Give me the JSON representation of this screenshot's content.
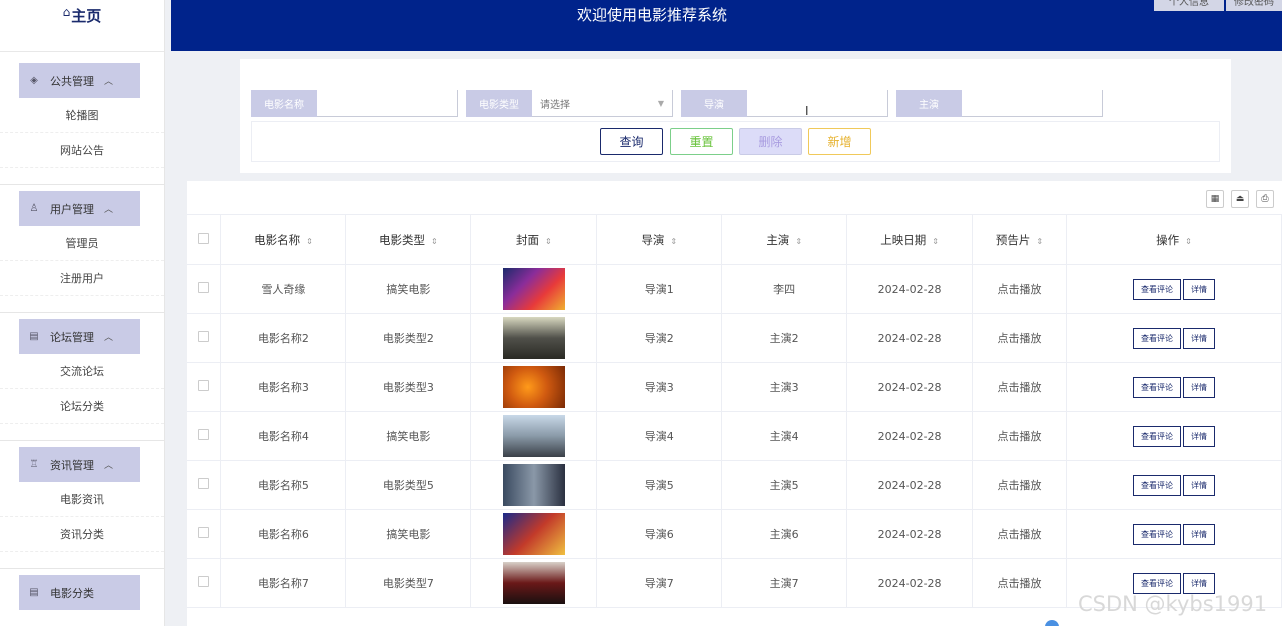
{
  "brand": {
    "icon": "⌂",
    "title": "主页"
  },
  "header": {
    "title": "欢迎使用电影推荐系统",
    "buttons": [
      "个人信息",
      "修改密码"
    ]
  },
  "sidebar": {
    "groups": [
      {
        "label": "公共管理",
        "icon": "layers-icon",
        "items": [
          "轮播图",
          "网站公告"
        ]
      },
      {
        "label": "用户管理",
        "icon": "user-icon",
        "items": [
          "管理员",
          "注册用户"
        ]
      },
      {
        "label": "论坛管理",
        "icon": "list-icon",
        "items": [
          "交流论坛",
          "论坛分类"
        ]
      },
      {
        "label": "资讯管理",
        "icon": "news-icon",
        "items": [
          "电影资讯",
          "资讯分类"
        ]
      },
      {
        "label": "电影分类",
        "icon": "list-icon",
        "items": []
      }
    ]
  },
  "search": {
    "fields": [
      {
        "label": "电影名称",
        "value": ""
      },
      {
        "label": "电影类型",
        "placeholder": "请选择"
      },
      {
        "label": "导演",
        "value": ""
      },
      {
        "label": "主演",
        "value": ""
      }
    ],
    "buttons": {
      "query": "查询",
      "reset": "重置",
      "delete": "删除",
      "add": "新增"
    }
  },
  "table": {
    "columns": [
      "电影名称",
      "电影类型",
      "封面",
      "导演",
      "主演",
      "上映日期",
      "预告片",
      "操作"
    ],
    "rows": [
      {
        "name": "雪人奇缘",
        "type": "搞笑电影",
        "director": "导演1",
        "actor": "李四",
        "date": "2024-02-28",
        "trailer": "点击播放"
      },
      {
        "name": "电影名称2",
        "type": "电影类型2",
        "director": "导演2",
        "actor": "主演2",
        "date": "2024-02-28",
        "trailer": "点击播放"
      },
      {
        "name": "电影名称3",
        "type": "电影类型3",
        "director": "导演3",
        "actor": "主演3",
        "date": "2024-02-28",
        "trailer": "点击播放"
      },
      {
        "name": "电影名称4",
        "type": "搞笑电影",
        "director": "导演4",
        "actor": "主演4",
        "date": "2024-02-28",
        "trailer": "点击播放"
      },
      {
        "name": "电影名称5",
        "type": "电影类型5",
        "director": "导演5",
        "actor": "主演5",
        "date": "2024-02-28",
        "trailer": "点击播放"
      },
      {
        "name": "电影名称6",
        "type": "搞笑电影",
        "director": "导演6",
        "actor": "主演6",
        "date": "2024-02-28",
        "trailer": "点击播放"
      },
      {
        "name": "电影名称7",
        "type": "电影类型7",
        "director": "导演7",
        "actor": "主演7",
        "date": "2024-02-28",
        "trailer": "点击播放"
      }
    ],
    "actions": {
      "comments": "查看评论",
      "detail": "详情"
    }
  },
  "watermark": "CSDN @kybs1991"
}
